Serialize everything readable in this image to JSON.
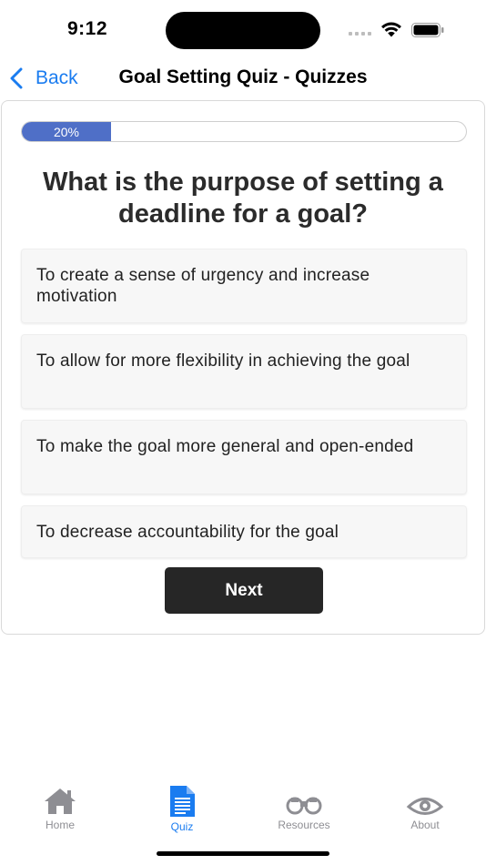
{
  "status_bar": {
    "time": "9:12"
  },
  "nav": {
    "back_label": "Back",
    "title": "Goal Setting Quiz - Quizzes"
  },
  "quiz": {
    "progress_percent": 20,
    "progress_label": "20%",
    "question": "What is the purpose of setting a deadline for a goal?",
    "options": [
      "To create a sense of urgency and increase motivation",
      "To allow for more flexibility in achieving the goal",
      "To make the goal more general and open-ended",
      "To decrease accountability for the goal"
    ],
    "next_label": "Next"
  },
  "tab_bar": {
    "tabs": [
      {
        "label": "Home",
        "icon": "home-icon",
        "active": false
      },
      {
        "label": "Quiz",
        "icon": "document-icon",
        "active": true
      },
      {
        "label": "Resources",
        "icon": "binoculars-icon",
        "active": false
      },
      {
        "label": "About",
        "icon": "eye-icon",
        "active": false
      }
    ]
  },
  "colors": {
    "accent": "#1a7cf0",
    "progress_fill": "#4f6fc7",
    "button_bg": "#262626",
    "inactive_tab": "#8e8e93"
  }
}
